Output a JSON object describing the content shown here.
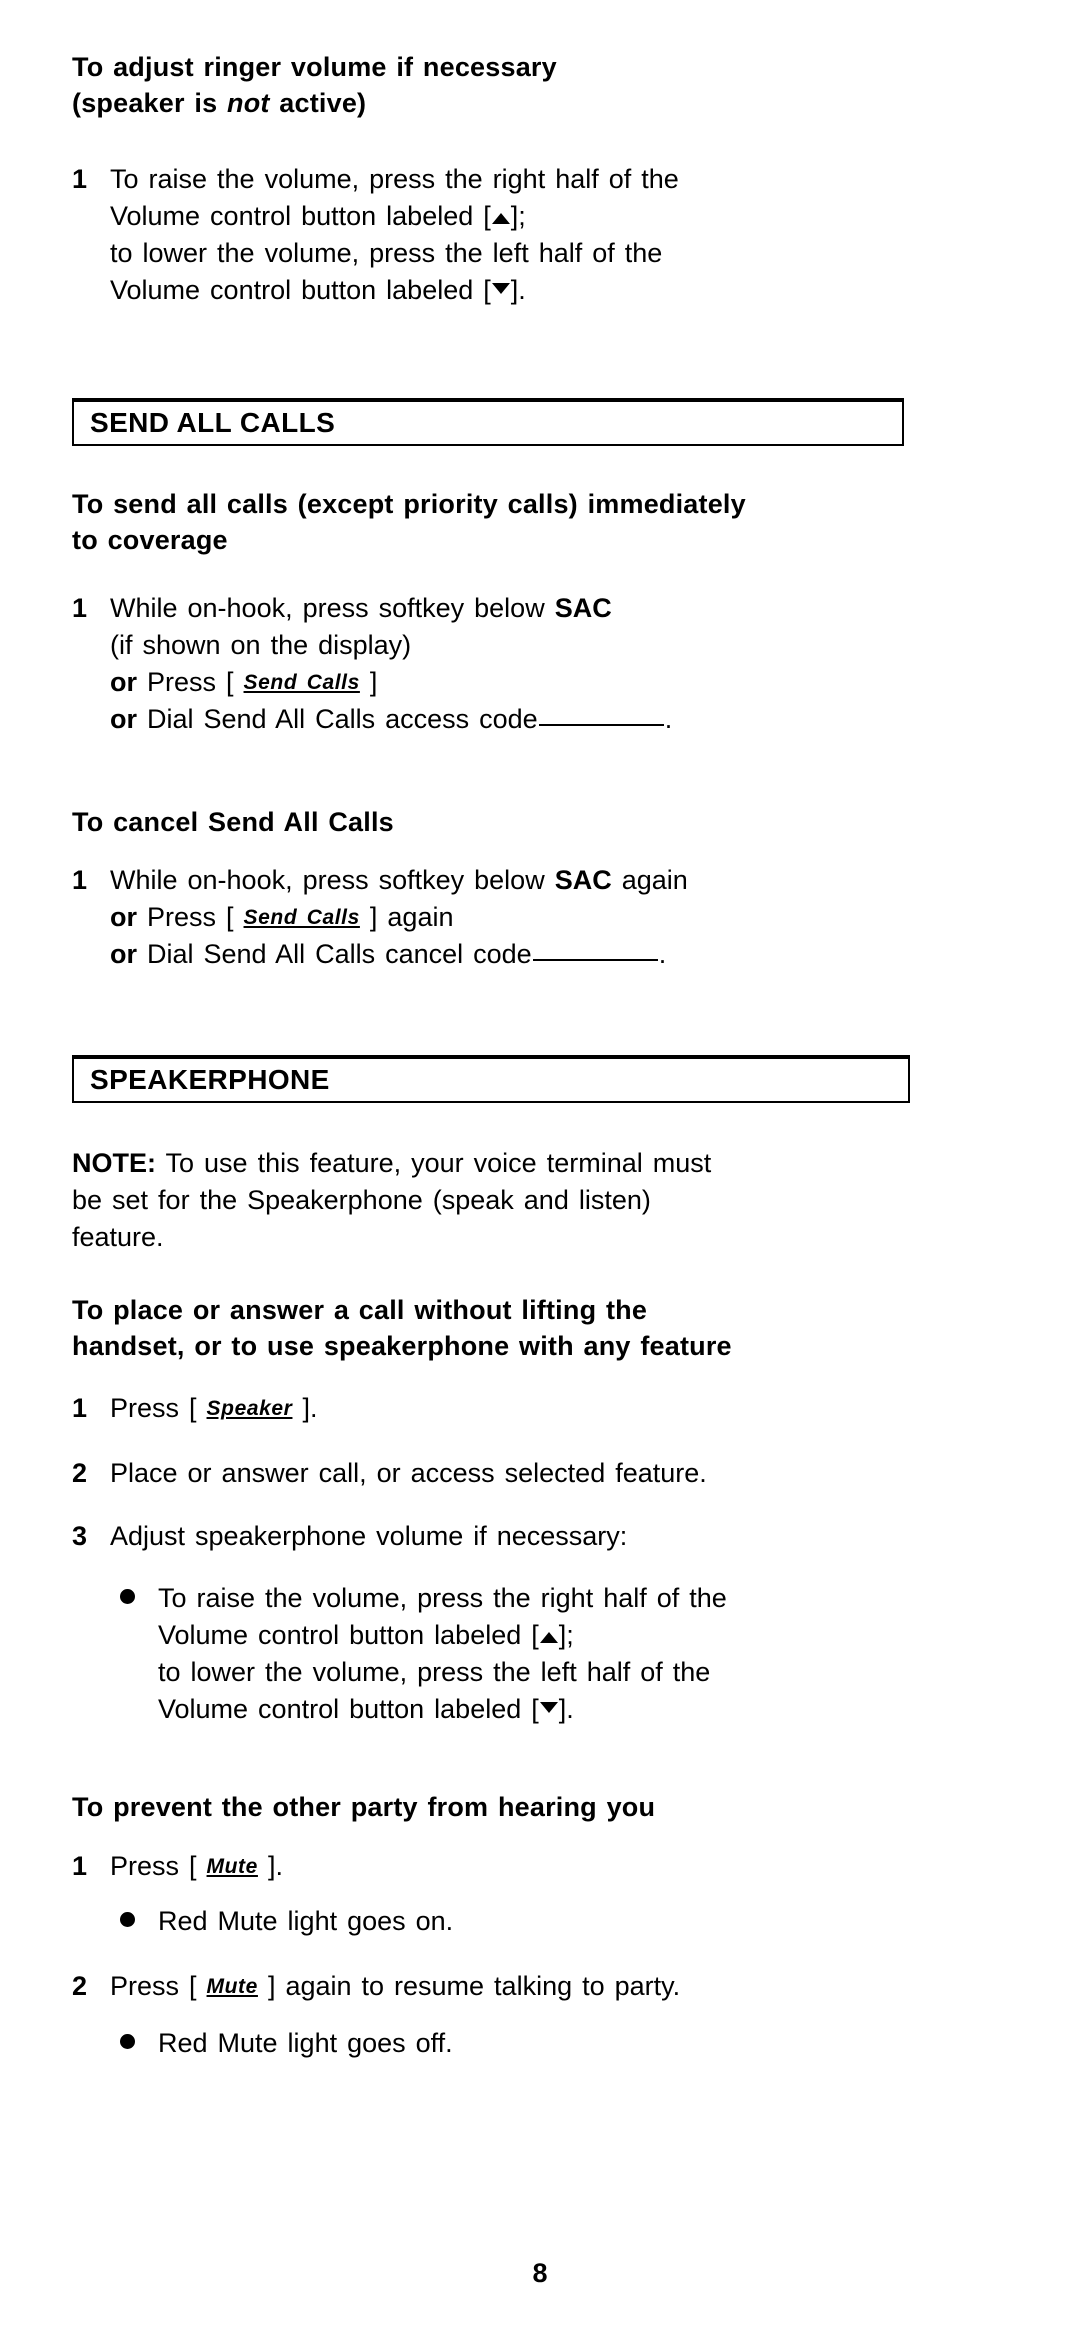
{
  "document": {
    "page_number": "8"
  },
  "ringer": {
    "heading_line1": "To adjust ringer volume if necessary",
    "heading_line2_pre": "(speaker is ",
    "heading_line2_ital": "not",
    "heading_line2_post": " active)",
    "step1": {
      "num": "1",
      "line1": "To raise the volume, press the right half of the",
      "line2_pre": "Volume control button labeled [",
      "line2_post": "];",
      "line3": "to lower the volume, press the left half of the",
      "line4_pre": "Volume control button labeled [",
      "line4_post": "]."
    }
  },
  "send_all_calls": {
    "section_title": "SEND ALL CALLS",
    "sub1_line1": "To send all calls (except priority calls) immediately",
    "sub1_line2": "to coverage",
    "step1": {
      "num": "1",
      "line1_pre": "While on-hook, press softkey below ",
      "line1_bold": "SAC",
      "line2": "(if shown on the display)",
      "line3_or": "or",
      "line3_pre": " Press [ ",
      "line3_token": "Send Calls",
      "line3_post": " ]",
      "line4_or": "or",
      "line4_pre": " Dial Send All Calls access code",
      "line4_post": "."
    },
    "sub2": "To cancel Send All Calls",
    "step2": {
      "num": "1",
      "line1_pre": "While on-hook, press softkey below ",
      "line1_bold": "SAC",
      "line1_post": " again",
      "line2_or": "or",
      "line2_pre": " Press [ ",
      "line2_token": "Send Calls",
      "line2_post": " ] again",
      "line3_or": "or",
      "line3_pre": " Dial Send All Calls cancel code",
      "line3_post": "."
    }
  },
  "speakerphone": {
    "section_title": "SPEAKERPHONE",
    "note_label": "NOTE:",
    "note_line1": " To use this feature, your voice terminal must",
    "note_line2": "be set for the Speakerphone (speak and listen)",
    "note_line3": "feature.",
    "sub1_line1": "To place or answer a call without lifting the",
    "sub1_line2": "handset, or to use speakerphone with any feature",
    "step1": {
      "num": "1",
      "pre": "Press [ ",
      "token": "Speaker",
      "post": " ]."
    },
    "step2": {
      "num": "2",
      "text": "Place or answer call, or access selected feature."
    },
    "step3": {
      "num": "3",
      "text": "Adjust speakerphone volume if necessary:"
    },
    "bullet1": {
      "line1": "To raise the volume, press the right half of the",
      "line2_pre": "Volume control button labeled [",
      "line2_post": "];",
      "line3": "to lower the volume, press the left half of the",
      "line4_pre": "Volume control button labeled [",
      "line4_post": "]."
    },
    "sub2": "To prevent the other party from hearing you",
    "mute_step1": {
      "num": "1",
      "pre": "Press [ ",
      "token": "Mute",
      "post": " ]."
    },
    "mute_bullet1": "Red Mute light goes on.",
    "mute_step2": {
      "num": "2",
      "pre": "Press [ ",
      "token": "Mute",
      "post": " ] again to resume talking to party."
    },
    "mute_bullet2": "Red Mute light goes off."
  }
}
